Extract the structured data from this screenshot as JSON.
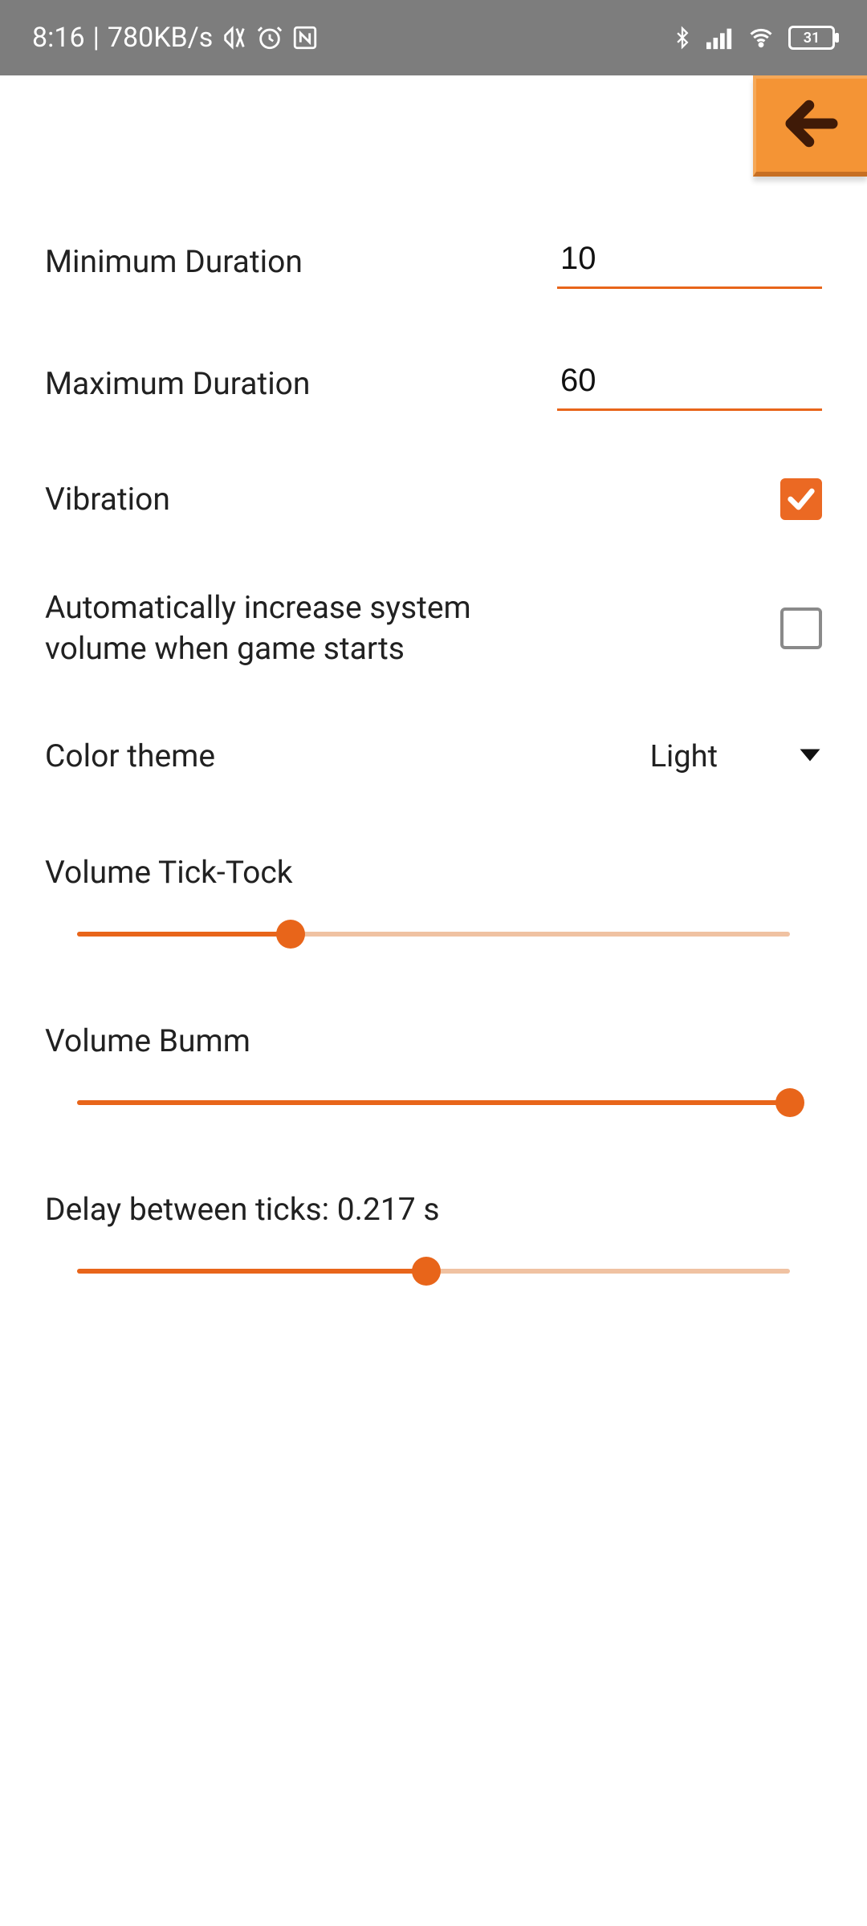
{
  "statusbar": {
    "time": "8:16",
    "network_speed": "780KB/s",
    "battery_level": "31",
    "icons": [
      "mute",
      "alarm",
      "nfc",
      "bluetooth",
      "signal",
      "wifi",
      "battery"
    ]
  },
  "settings": {
    "min_duration": {
      "label": "Minimum Duration",
      "value": "10"
    },
    "max_duration": {
      "label": "Maximum Duration",
      "value": "60"
    },
    "vibration": {
      "label": "Vibration",
      "checked": true
    },
    "auto_volume": {
      "label": "Automatically increase system volume when game starts",
      "checked": false
    },
    "color_theme": {
      "label": "Color theme",
      "value": "Light"
    },
    "vol_tick": {
      "label": "Volume Tick-Tock",
      "percent": 30
    },
    "vol_bumm": {
      "label": "Volume Bumm",
      "percent": 100
    },
    "tick_delay": {
      "label": "Delay between ticks: 0.217 s",
      "percent": 49,
      "value_seconds": 0.217
    }
  },
  "colors": {
    "accent": "#e8651a",
    "back_button_bg": "#f49435"
  }
}
